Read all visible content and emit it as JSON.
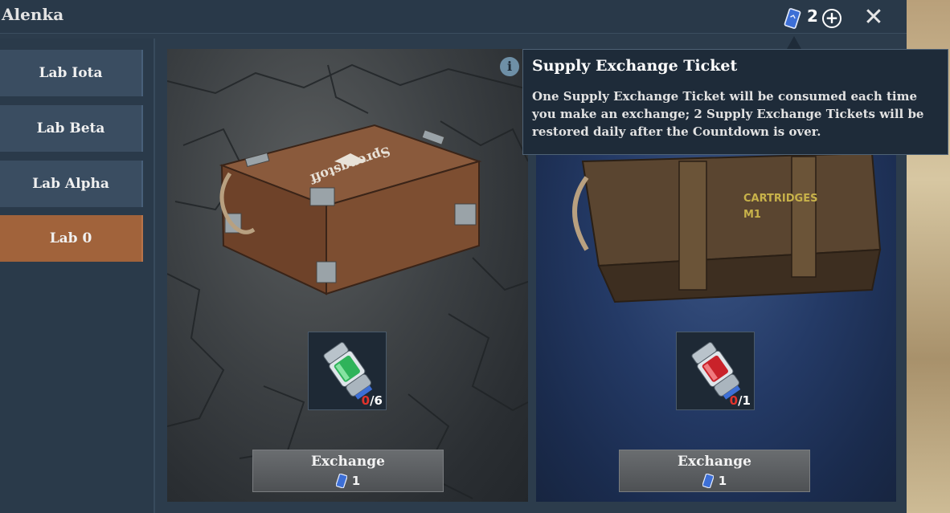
{
  "window": {
    "title": "Alenka"
  },
  "header": {
    "ticket_icon": "supply-ticket-icon",
    "ticket_count": "2",
    "add_label": "+",
    "close_label": "✕"
  },
  "sidebar": {
    "items": [
      {
        "label": "Lab Iota",
        "active": false
      },
      {
        "label": "Lab Beta",
        "active": false
      },
      {
        "label": "Lab Alpha",
        "active": false
      },
      {
        "label": "Lab 0",
        "active": true
      }
    ]
  },
  "cards": [
    {
      "crate": "wooden-supply-crate",
      "item_icon": "green-canister-icon",
      "owned": "0",
      "required": "/6",
      "button_label": "Exchange",
      "cost": "1"
    },
    {
      "crate": "military-ammo-crate",
      "item_icon": "red-canister-icon",
      "owned": "0",
      "required": "/1",
      "button_label": "Exchange",
      "cost": "1"
    }
  ],
  "info": {
    "label": "i"
  },
  "tooltip": {
    "title": "Supply Exchange Ticket",
    "body": "One Supply Exchange Ticket will be consumed each time you make an exchange; 2 Supply Exchange Tickets will be restored daily after the Countdown is over."
  },
  "colors": {
    "active_tab": "#a1633b",
    "panel": "#2c3c4c",
    "count_zero": "#e0332c"
  }
}
